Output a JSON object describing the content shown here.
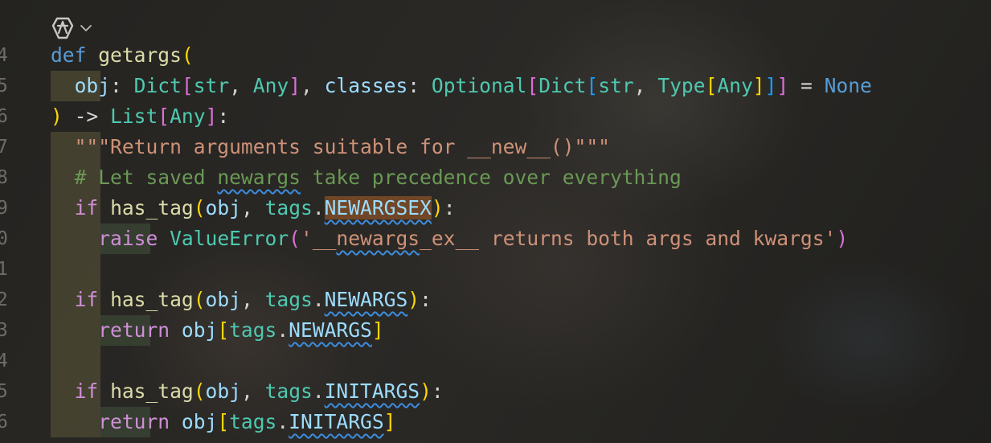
{
  "editor": {
    "line_numbers": [
      "4",
      "5",
      "6",
      "7",
      "8",
      "9",
      "0",
      "1",
      "2",
      "3",
      "4",
      "5",
      "6"
    ],
    "ai_toolbar": {
      "icon": "ai-assistant-icon",
      "chevron": "chevron-down-icon"
    },
    "tokens": {
      "def": "def",
      "getargs": "getargs",
      "obj": "obj",
      "Dict": "Dict",
      "str": "str",
      "Any": "Any",
      "classes": "classes",
      "Optional": "Optional",
      "Type": "Type",
      "None": "None",
      "arrow": "->",
      "List": "List",
      "docstring": "\"\"\"Return arguments suitable for __new__()\"\"\"",
      "comment_pre": "# Let saved ",
      "comment_word": "newargs",
      "comment_post": " take precedence over everything",
      "if": "if",
      "has_tag": "has_tag",
      "tags": "tags",
      "NEWARGSEX": "NEWARGSEX",
      "raise": "raise",
      "ValueError": "ValueError",
      "err_pre": "'__",
      "err_word": "newargs",
      "err_mid": "_ex__",
      "err_post": " returns both args and kwargs'",
      "NEWARGS": "NEWARGS",
      "return": "return",
      "INITARGS": "INITARGS"
    },
    "colors": {
      "background": "#22211f",
      "keyword": "#cf8ed6",
      "def_keyword": "#569cd6",
      "function": "#dcdcaa",
      "class": "#4ec9b0",
      "parameter": "#9cdcfe",
      "string": "#ce9178",
      "comment": "#6a9955"
    }
  }
}
